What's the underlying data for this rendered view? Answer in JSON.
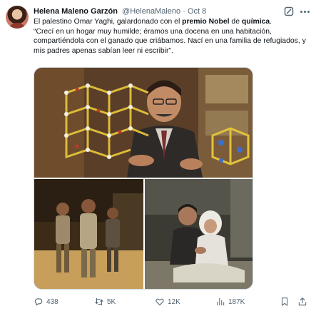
{
  "tweet": {
    "author_name": "Helena Maleno Garzón",
    "handle": "@HelenaMaleno",
    "separator": "·",
    "date": "Oct 8",
    "text": {
      "p1": "El palestino Omar Yaghi, galardonado con el ",
      "b1": "premio Nobel",
      "p2": " de ",
      "b2": "química",
      "p3": ".",
      "quote": "“Crecí en un hogar muy humilde; éramos una docena en una habitación, compartiéndola con el ganado que criábamos. Nací en una familia de refugiados, y mis padres apenas sabían leer ni escribir”."
    }
  },
  "actions": {
    "replies": "438",
    "retweets": "5K",
    "likes": "12K",
    "views": "187K"
  },
  "icons": {
    "grok": "grok-icon",
    "more": "more-icon",
    "reply": "reply-icon",
    "retweet": "retweet-icon",
    "like": "heart-icon",
    "views": "views-icon",
    "bookmark": "bookmark-icon",
    "share": "share-icon"
  },
  "colors": {
    "text_primary": "#0f1419",
    "text_secondary": "#536471",
    "border": "#cfd9de"
  }
}
